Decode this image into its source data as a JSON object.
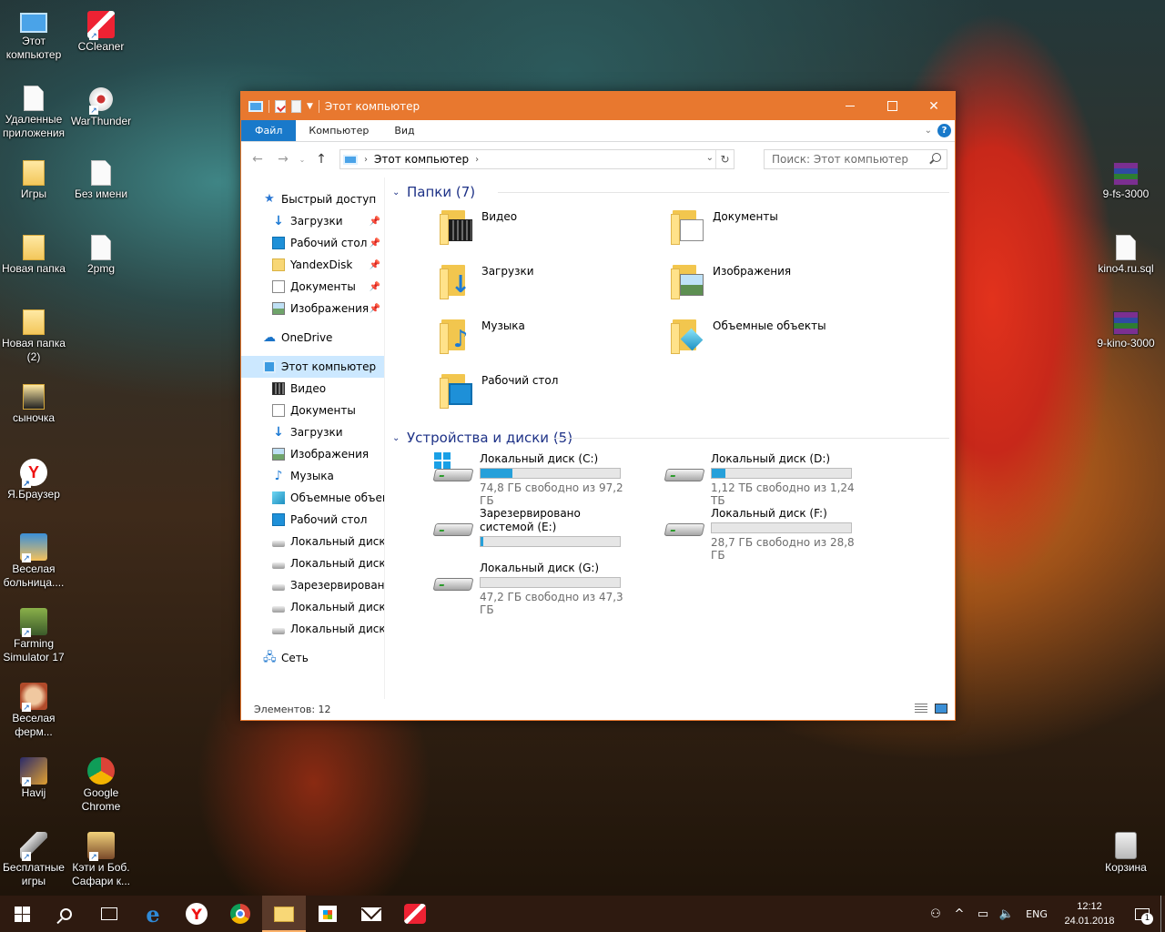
{
  "desktop": {
    "left_icons": [
      {
        "label": "Этот компьютер",
        "icon": "pc-icon"
      },
      {
        "label": "CCleaner",
        "icon": "ccleaner-icon"
      },
      {
        "label": "Удаленные приложения",
        "icon": "file-icon"
      },
      {
        "label": "WarThunder",
        "icon": "warthunder-icon"
      },
      {
        "label": "Игры",
        "icon": "folder-icon"
      },
      {
        "label": "Без имени",
        "icon": "file-icon"
      },
      {
        "label": "Новая папка",
        "icon": "folder-icon"
      },
      {
        "label": "2pmg",
        "icon": "file-icon"
      },
      {
        "label": "Новая папка (2)",
        "icon": "folder-icon"
      },
      {
        "label": "сыночка",
        "icon": "folder-icon"
      },
      {
        "label": "Я.Браузер",
        "icon": "yandex-browser-icon"
      },
      {
        "label": "Веселая больница....",
        "icon": "game-icon"
      },
      {
        "label": "Farming Simulator 17",
        "icon": "game-icon"
      },
      {
        "label": "Веселая ферм...",
        "icon": "game-icon"
      },
      {
        "label": "Havij",
        "icon": "havij-icon"
      },
      {
        "label": "Google Chrome",
        "icon": "chrome-icon"
      },
      {
        "label": "Бесплатные игры",
        "icon": "games-icon"
      },
      {
        "label": "Кэти и Боб. Сафари к...",
        "icon": "game-icon"
      }
    ],
    "right_icons": [
      {
        "label": "9-fs-3000",
        "icon": "winrar-icon"
      },
      {
        "label": "kino4.ru.sql",
        "icon": "file-icon"
      },
      {
        "label": "9-kino-3000",
        "icon": "winrar-icon"
      },
      {
        "label": "Корзина",
        "icon": "recycle-bin-icon"
      }
    ]
  },
  "window": {
    "title": "Этот компьютер",
    "accent": "#e8782f",
    "ribbon_tabs": [
      "Файл",
      "Компьютер",
      "Вид"
    ],
    "address": {
      "crumb": "Этот компьютер"
    },
    "search_placeholder": "Поиск: Этот компьютер",
    "nav": {
      "quick_access": "Быстрый доступ",
      "pinned": [
        "Загрузки",
        "Рабочий стол",
        "YandexDisk",
        "Документы",
        "Изображения"
      ],
      "onedrive": "OneDrive",
      "this_pc": "Этот компьютер",
      "pc_items": [
        "Видео",
        "Документы",
        "Загрузки",
        "Изображения",
        "Музыка",
        "Объемные объекты",
        "Рабочий стол",
        "Локальный диск (C",
        "Локальный диск (D",
        "Зарезервировано с",
        "Локальный диск (F",
        "Локальный диск (G"
      ],
      "network": "Сеть"
    },
    "folders_header": "Папки (7)",
    "folders": [
      "Видео",
      "Документы",
      "Загрузки",
      "Изображения",
      "Музыка",
      "Объемные объекты",
      "Рабочий стол"
    ],
    "drives_header": "Устройства и диски (5)",
    "drives": [
      {
        "name": "Локальный диск (C:)",
        "free": "74,8 ГБ свободно из 97,2 ГБ",
        "used_fraction": 0.23
      },
      {
        "name": "Локальный диск (D:)",
        "free": "1,12 ТБ свободно из 1,24 ТБ",
        "used_fraction": 0.1
      },
      {
        "name": "Зарезервировано системой (E:)",
        "free": "",
        "used_fraction": 0.02
      },
      {
        "name": "Локальный диск (F:)",
        "free": "28,7 ГБ свободно из 28,8 ГБ",
        "used_fraction": 0.0
      },
      {
        "name": "Локальный диск (G:)",
        "free": "47,2 ГБ свободно из 47,3 ГБ",
        "used_fraction": 0.0
      }
    ],
    "status": "Элементов: 12"
  },
  "taskbar": {
    "lang": "ENG",
    "time": "12:12",
    "date": "24.01.2018",
    "notification_count": "1"
  }
}
